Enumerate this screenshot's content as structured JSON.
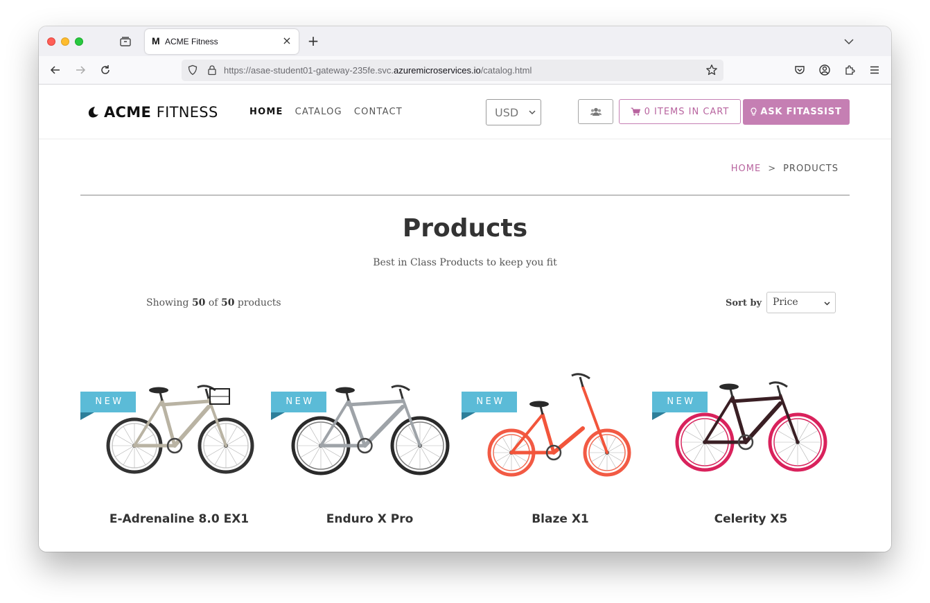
{
  "browser": {
    "tab_title": "ACME Fitness",
    "tab_favicon": "M",
    "url_prefix": "https://asae-student01-gateway-235fe.svc.",
    "url_domain": "azuremicroservices.io",
    "url_path": "/catalog.html",
    "icons": [
      "tab-list-icon",
      "close-icon",
      "plus-icon",
      "chevron-down-icon",
      "back-icon",
      "forward-icon",
      "reload-icon",
      "shield-icon",
      "lock-icon",
      "star-icon",
      "pocket-icon",
      "account-icon",
      "extensions-icon",
      "menu-icon"
    ]
  },
  "header": {
    "logo_bold": "ACME",
    "logo_thin": "FITNESS",
    "menu": [
      {
        "label": "HOME"
      },
      {
        "label": "CATALOG"
      },
      {
        "label": "CONTACT"
      }
    ],
    "currency": "USD",
    "cart_label": "0 ITEMS IN CART",
    "ask_label": "ASK FITASSIST"
  },
  "breadcrumb": {
    "home": "HOME",
    "separator": ">",
    "current": "PRODUCTS"
  },
  "page": {
    "title": "Products",
    "subtitle": "Best in Class Products to keep you fit"
  },
  "listing": {
    "showing_prefix": "Showing",
    "shown_count": "50",
    "of_text": "of",
    "total_count": "50",
    "suffix": "products",
    "sort_label": "Sort by",
    "sort_value": "Price"
  },
  "products": [
    {
      "name": "E-Adrenaline 8.0 EX1",
      "badge": "NEW",
      "frame_color": "#b9b3a3",
      "rim_color": "#c9c9c9",
      "tire_color": "#333333"
    },
    {
      "name": "Enduro X Pro",
      "badge": "NEW",
      "frame_color": "#9ea3a8",
      "rim_color": "#7a7a7a",
      "tire_color": "#2a2a2a"
    },
    {
      "name": "Blaze X1",
      "badge": "NEW",
      "frame_color": "#f2553b",
      "rim_color": "#f26a52",
      "tire_color": "#f25a44"
    },
    {
      "name": "Celerity X5",
      "badge": "NEW",
      "frame_color": "#3a1f24",
      "rim_color": "#d9225c",
      "tire_color": "#d9225c"
    }
  ],
  "colors": {
    "accent": "#c57fb3",
    "badge": "#5bbbd7",
    "badge_fold": "#2d7f9a"
  }
}
